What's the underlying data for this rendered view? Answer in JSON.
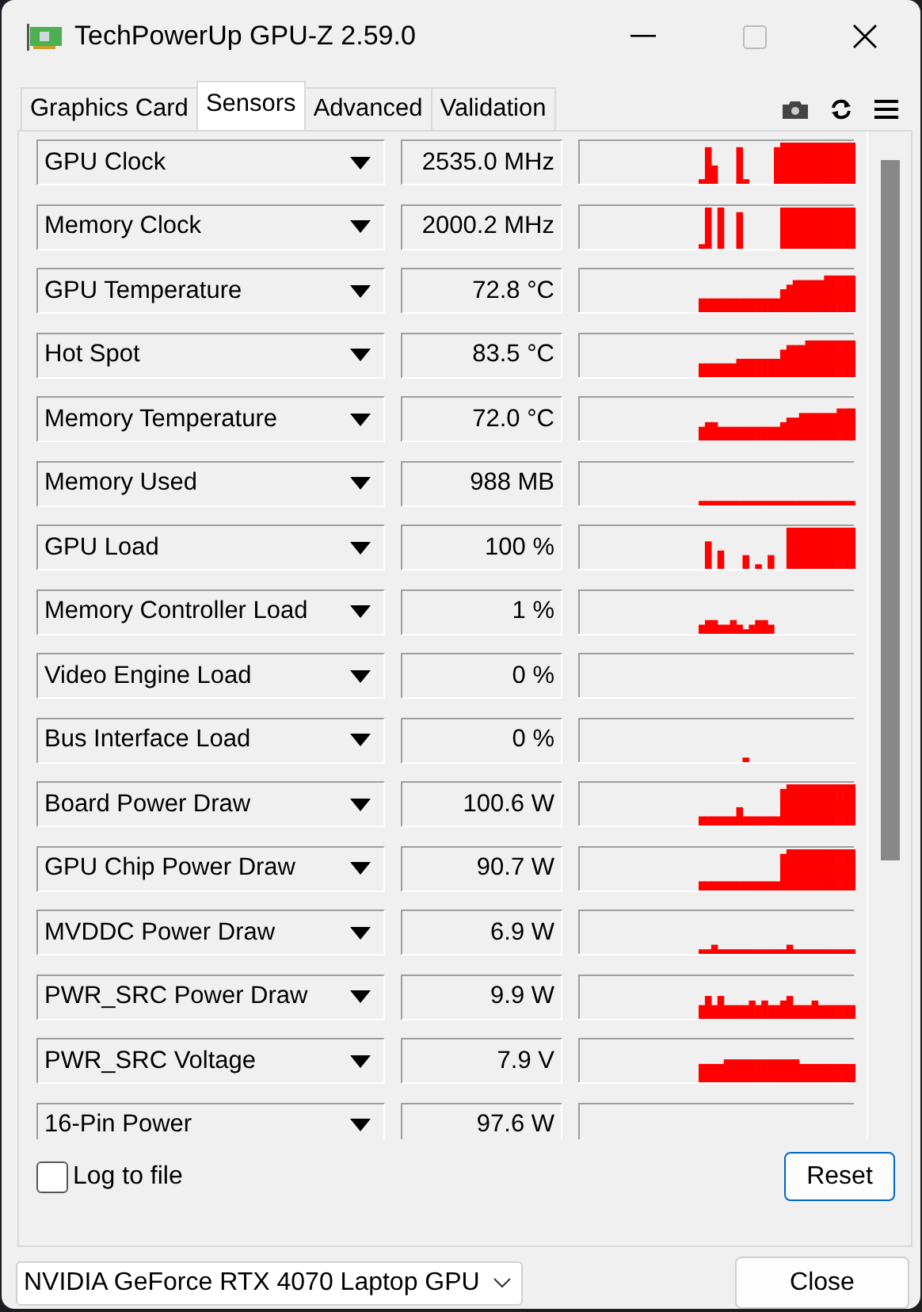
{
  "window": {
    "title": "TechPowerUp GPU-Z 2.59.0"
  },
  "tabs": [
    {
      "label": "Graphics Card",
      "selected": false
    },
    {
      "label": "Sensors",
      "selected": true
    },
    {
      "label": "Advanced",
      "selected": false
    },
    {
      "label": "Validation",
      "selected": false
    }
  ],
  "sensors": [
    {
      "name": "GPU Clock",
      "value": "2535.0 MHz"
    },
    {
      "name": "Memory Clock",
      "value": "2000.2 MHz"
    },
    {
      "name": "GPU Temperature",
      "value": "72.8 °C"
    },
    {
      "name": "Hot Spot",
      "value": "83.5 °C"
    },
    {
      "name": "Memory Temperature",
      "value": "72.0 °C"
    },
    {
      "name": "Memory Used",
      "value": "988 MB"
    },
    {
      "name": "GPU Load",
      "value": "100 %"
    },
    {
      "name": "Memory Controller Load",
      "value": "1 %"
    },
    {
      "name": "Video Engine Load",
      "value": "0 %"
    },
    {
      "name": "Bus Interface Load",
      "value": "0 %"
    },
    {
      "name": "Board Power Draw",
      "value": "100.6 W"
    },
    {
      "name": "GPU Chip Power Draw",
      "value": "90.7 W"
    },
    {
      "name": "MVDDC Power Draw",
      "value": "6.9 W"
    },
    {
      "name": "PWR_SRC Power Draw",
      "value": "9.9 W"
    },
    {
      "name": "PWR_SRC Voltage",
      "value": "7.9 V"
    },
    {
      "name": "16-Pin Power",
      "value": "97.6 W"
    }
  ],
  "log_to_file": {
    "label": "Log to file",
    "checked": false
  },
  "reset_button": "Reset",
  "gpu_select": {
    "value": "NVIDIA GeForce RTX 4070 Laptop GPU"
  },
  "close_button": "Close"
}
